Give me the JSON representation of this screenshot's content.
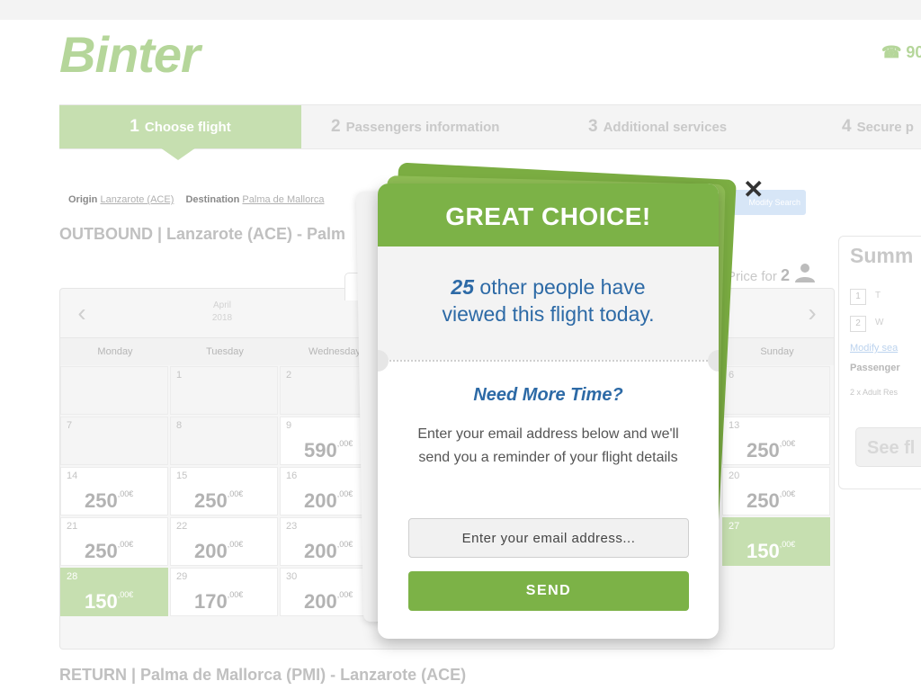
{
  "brand": {
    "logo": "Binter",
    "phone": "☎ 90"
  },
  "steps": [
    {
      "num": "1",
      "label": "Choose flight"
    },
    {
      "num": "2",
      "label": "Passengers information"
    },
    {
      "num": "3",
      "label": "Additional services"
    },
    {
      "num": "4",
      "label": "Secure p"
    }
  ],
  "route": {
    "origin_label": "Origin",
    "origin_value": "Lanzarote (ACE)",
    "destination_label": "Destination",
    "destination_value": "Palma de Mallorca",
    "modify_label": "Modify Search"
  },
  "outbound_title": "OUTBOUND | Lanzarote (ACE) - Palm",
  "price_for": {
    "label": "Price for",
    "count": "2"
  },
  "calendar": {
    "prev": "‹",
    "next": "›",
    "month": "April",
    "year": "2018",
    "days": [
      "Monday",
      "Tuesday",
      "Wednesday",
      "Sunday"
    ],
    "cells": [
      {
        "day": "",
        "price": "",
        "state": "empty"
      },
      {
        "day": "1",
        "price": "",
        "state": "empty"
      },
      {
        "day": "2",
        "price": "",
        "state": "empty"
      },
      {
        "day": "6",
        "price": "",
        "state": "empty"
      },
      {
        "day": "7",
        "price": "",
        "state": "empty"
      },
      {
        "day": "8",
        "price": "",
        "state": "empty"
      },
      {
        "day": "9",
        "price": "590",
        "state": "normal"
      },
      {
        "day": "13",
        "price": "250",
        "state": "normal"
      },
      {
        "day": "14",
        "price": "250",
        "state": "normal"
      },
      {
        "day": "15",
        "price": "250",
        "state": "normal"
      },
      {
        "day": "16",
        "price": "200",
        "state": "normal"
      },
      {
        "day": "20",
        "price": "250",
        "state": "normal"
      },
      {
        "day": "21",
        "price": "250",
        "state": "normal"
      },
      {
        "day": "22",
        "price": "200",
        "state": "normal"
      },
      {
        "day": "23",
        "price": "200",
        "state": "normal"
      },
      {
        "day": "27",
        "price": "150",
        "state": "green"
      },
      {
        "day": "28",
        "price": "150",
        "state": "green"
      },
      {
        "day": "29",
        "price": "170",
        "state": "normal"
      },
      {
        "day": "30",
        "price": "200",
        "state": "normal"
      }
    ],
    "currency_suffix": ",00€"
  },
  "return_title": "RETURN | Palma de Mallorca (PMI) - Lanzarote (ACE)",
  "summary": {
    "title": "Summ",
    "step1": "1",
    "step2": "2",
    "step1_text": "T",
    "step2_text": "W",
    "modify_link": "Modify sea",
    "passenger_label": "Passenger",
    "passenger_detail": "2 x Adult Res",
    "button_label": "See fl"
  },
  "modal": {
    "heading": "GREAT CHOICE!",
    "viewers_count": "25",
    "viewers_text_1": " other people have",
    "viewers_text_2": "viewed this flight today.",
    "subheading": "Need More Time?",
    "description": "Enter your email address below and we'll send you a reminder of your flight details",
    "email_placeholder": "Enter your email address...",
    "send_label": "SEND",
    "close_label": "✕"
  }
}
